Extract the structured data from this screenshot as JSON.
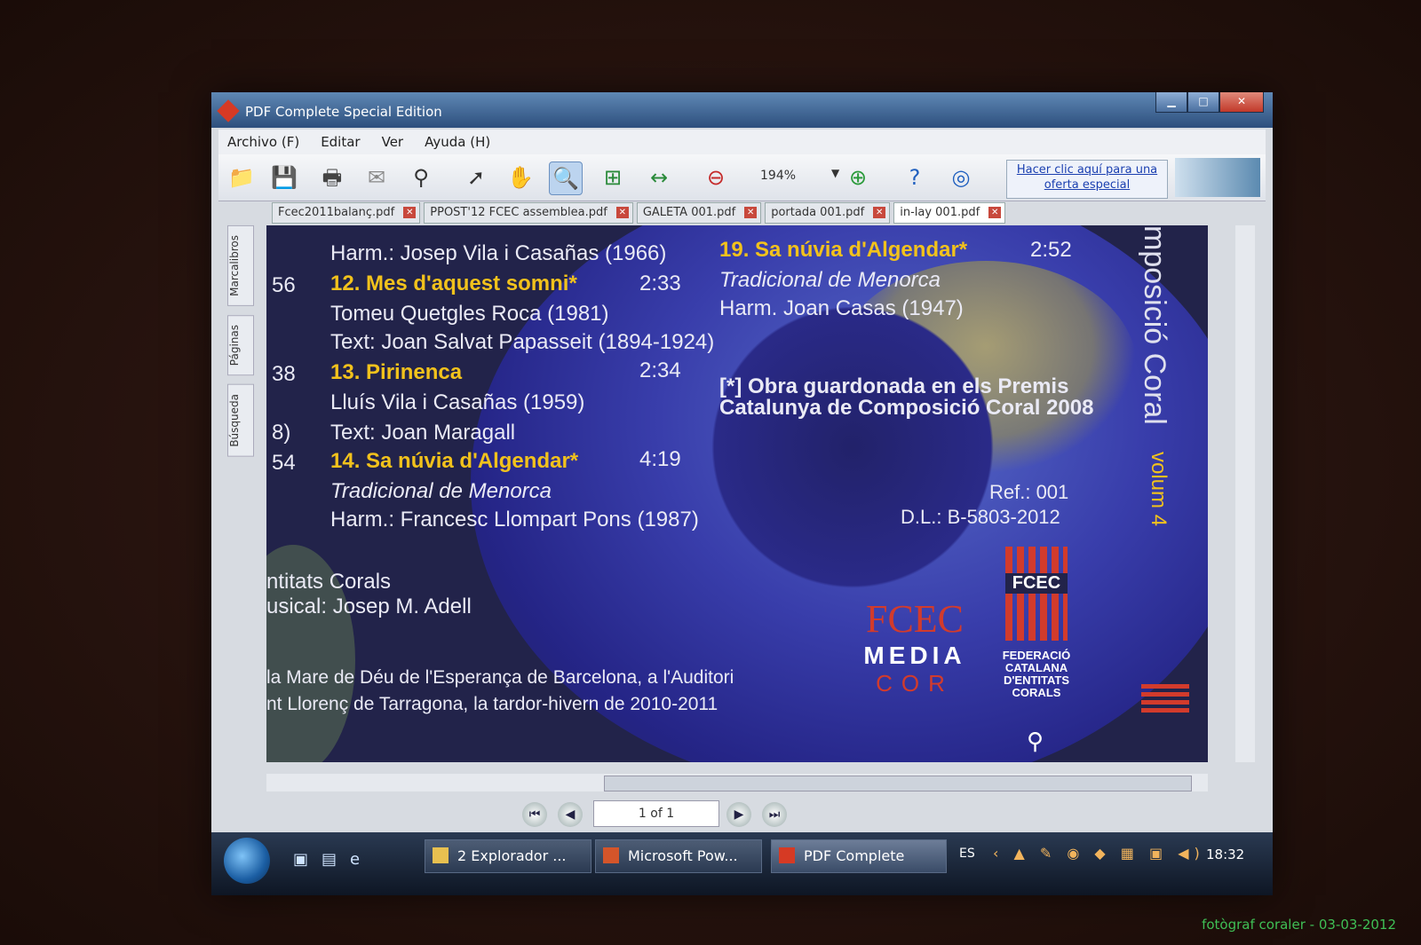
{
  "window": {
    "title": "PDF Complete Special Edition"
  },
  "menu": [
    "Archivo (F)",
    "Editar",
    "Ver",
    "Ayuda (H)"
  ],
  "toolbar": {
    "zoom": "194%",
    "promo": "Hacer clic aquí para una oferta especial"
  },
  "tabs": [
    {
      "label": "Fcec2011balanç.pdf"
    },
    {
      "label": "PPOST'12 FCEC assemblea.pdf"
    },
    {
      "label": "GALETA 001.pdf"
    },
    {
      "label": "portada 001.pdf"
    },
    {
      "label": "in-lay 001.pdf"
    }
  ],
  "sidebar": [
    "Marcalibros",
    "Páginas",
    "Búsqueda"
  ],
  "doc": {
    "l1": "Harm.: Josep Vila i Casañas (1966)",
    "n56": "56",
    "t12": "12. Mes d'aquest somni*",
    "d12": "2:33",
    "l12a": "Tomeu Quetgles Roca (1981)",
    "l12b": "Text: Joan Salvat Papasseit (1894-1924)",
    "n38": "38",
    "t13": "13. Pirinenca",
    "d13": "2:34",
    "l13a": "Lluís Vila i Casañas (1959)",
    "n8": "8)",
    "l13b": "Text: Joan Maragall",
    "n54": "54",
    "t14": "14. Sa núvia d'Algendar*",
    "d14": "4:19",
    "l14a": "Tradicional de Menorca",
    "l14b": "Harm.: Francesc Llompart Pons (1987)",
    "ec": "ntitats Corals",
    "dm": "usical: Josep M. Adell",
    "rec1": "la Mare de Déu de l'Esperança de Barcelona, a l'Auditori",
    "rec2": "nt Llorenç de Tarragona, la tardor-hivern de 2010-2011",
    "t19": "19. Sa núvia d'Algendar*",
    "d19": "2:52",
    "l19a": "Tradicional de Menorca",
    "l19b": "Harm. Joan Casas (1947)",
    "note1": "[*] Obra guardonada en els Premis",
    "note2": "Catalunya de Composició Coral 2008",
    "ref": "Ref.: 001",
    "dl": "D.L.: B-5803-2012",
    "vtitle": "mposició Coral",
    "vvol": "volum 4",
    "logo1a": "FCEC",
    "logo1b": "MEDIA",
    "logo1c": "COR",
    "fed": "FEDERACIÓ CATALANA D'ENTITATS CORALS"
  },
  "nav": {
    "page": "1 of 1"
  },
  "taskbar": {
    "tasks": [
      "2 Explorador ...",
      "Microsoft Pow...",
      "PDF Complete"
    ],
    "lang": "ES",
    "clock": "18:32"
  },
  "photo_credit": "fotògraf coraler - 03-03-2012"
}
